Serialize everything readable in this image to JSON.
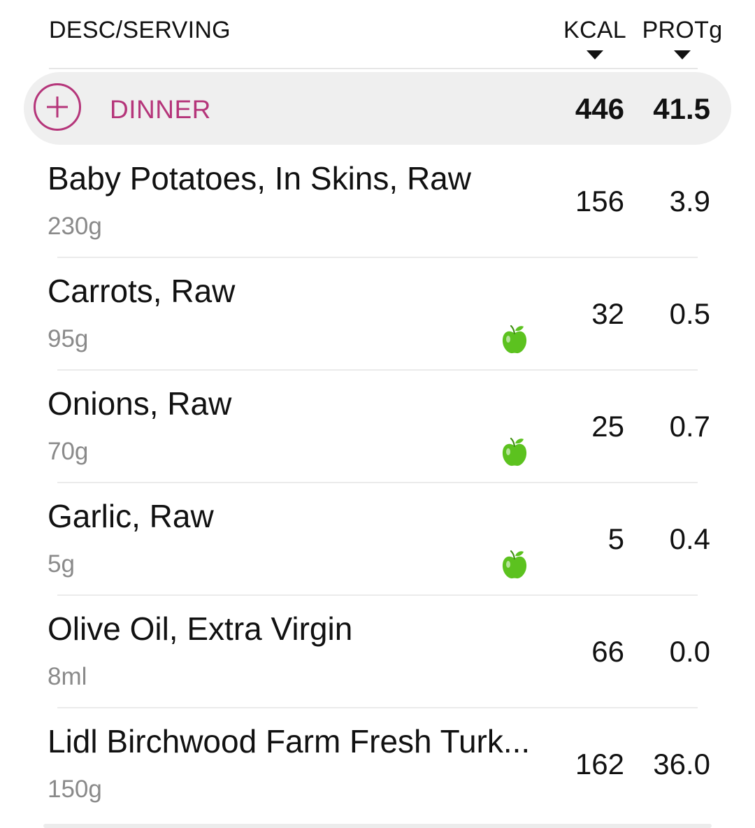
{
  "header": {
    "desc_label": "DESC/SERVING",
    "kcal_label": "KCAL",
    "prot_label": "PROTg"
  },
  "meal": {
    "name": "DINNER",
    "kcal": "446",
    "prot": "41.5"
  },
  "items": [
    {
      "name": "Baby Potatoes, In Skins, Raw",
      "serving": "230g",
      "kcal": "156",
      "prot": "3.9",
      "icon": ""
    },
    {
      "name": "Carrots, Raw",
      "serving": "95g",
      "kcal": "32",
      "prot": "0.5",
      "icon": "apple-icon"
    },
    {
      "name": "Onions, Raw",
      "serving": "70g",
      "kcal": "25",
      "prot": "0.7",
      "icon": "apple-icon"
    },
    {
      "name": "Garlic, Raw",
      "serving": "5g",
      "kcal": "5",
      "prot": "0.4",
      "icon": "apple-icon"
    },
    {
      "name": "Olive Oil, Extra Virgin",
      "serving": "8ml",
      "kcal": "66",
      "prot": "0.0",
      "icon": ""
    },
    {
      "name": "Lidl Birchwood Farm Fresh Turk...",
      "serving": "150g",
      "kcal": "162",
      "prot": "36.0",
      "icon": ""
    }
  ],
  "colors": {
    "accent": "#b5357a",
    "apple_green": "#5cc21f",
    "meal_bar_bg": "#efefef",
    "serving_gray": "#8a8a8a"
  }
}
